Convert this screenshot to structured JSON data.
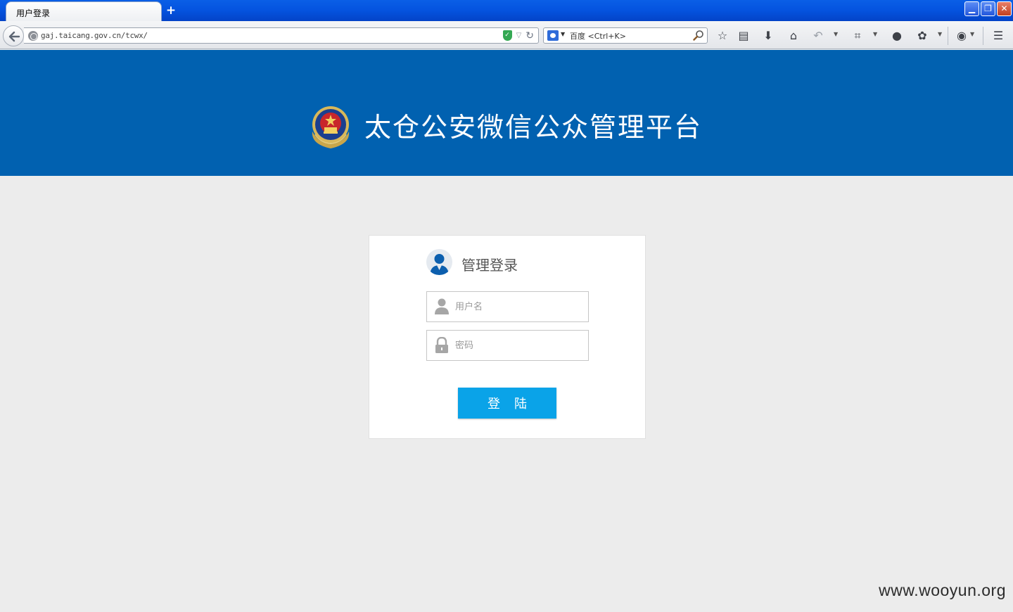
{
  "browser": {
    "tab_title": "用户登录",
    "new_tab_symbol": "+",
    "url": "gaj.taicang.gov.cn/tcwx/",
    "search_placeholder": "百度 <Ctrl+K>",
    "window_controls": {
      "minimize": "▁",
      "restore": "❐",
      "close": "✕"
    },
    "toolbar_icons": [
      "star-icon",
      "reading-list-icon",
      "download-icon",
      "home-icon",
      "undo-icon",
      "crop-icon",
      "chat-icon",
      "extension-icon",
      "web-icon",
      "menu-icon"
    ]
  },
  "header": {
    "title": "太仓公安微信公众管理平台",
    "emblem_icon": "police-emblem-icon"
  },
  "login": {
    "title": "管理登录",
    "username_placeholder": "用户名",
    "password_placeholder": "密码",
    "button_label": "登陆"
  },
  "watermark": "www.wooyun.org",
  "colors": {
    "banner": "#0161b0",
    "button": "#0aa3e8",
    "page_background": "#ececec"
  }
}
